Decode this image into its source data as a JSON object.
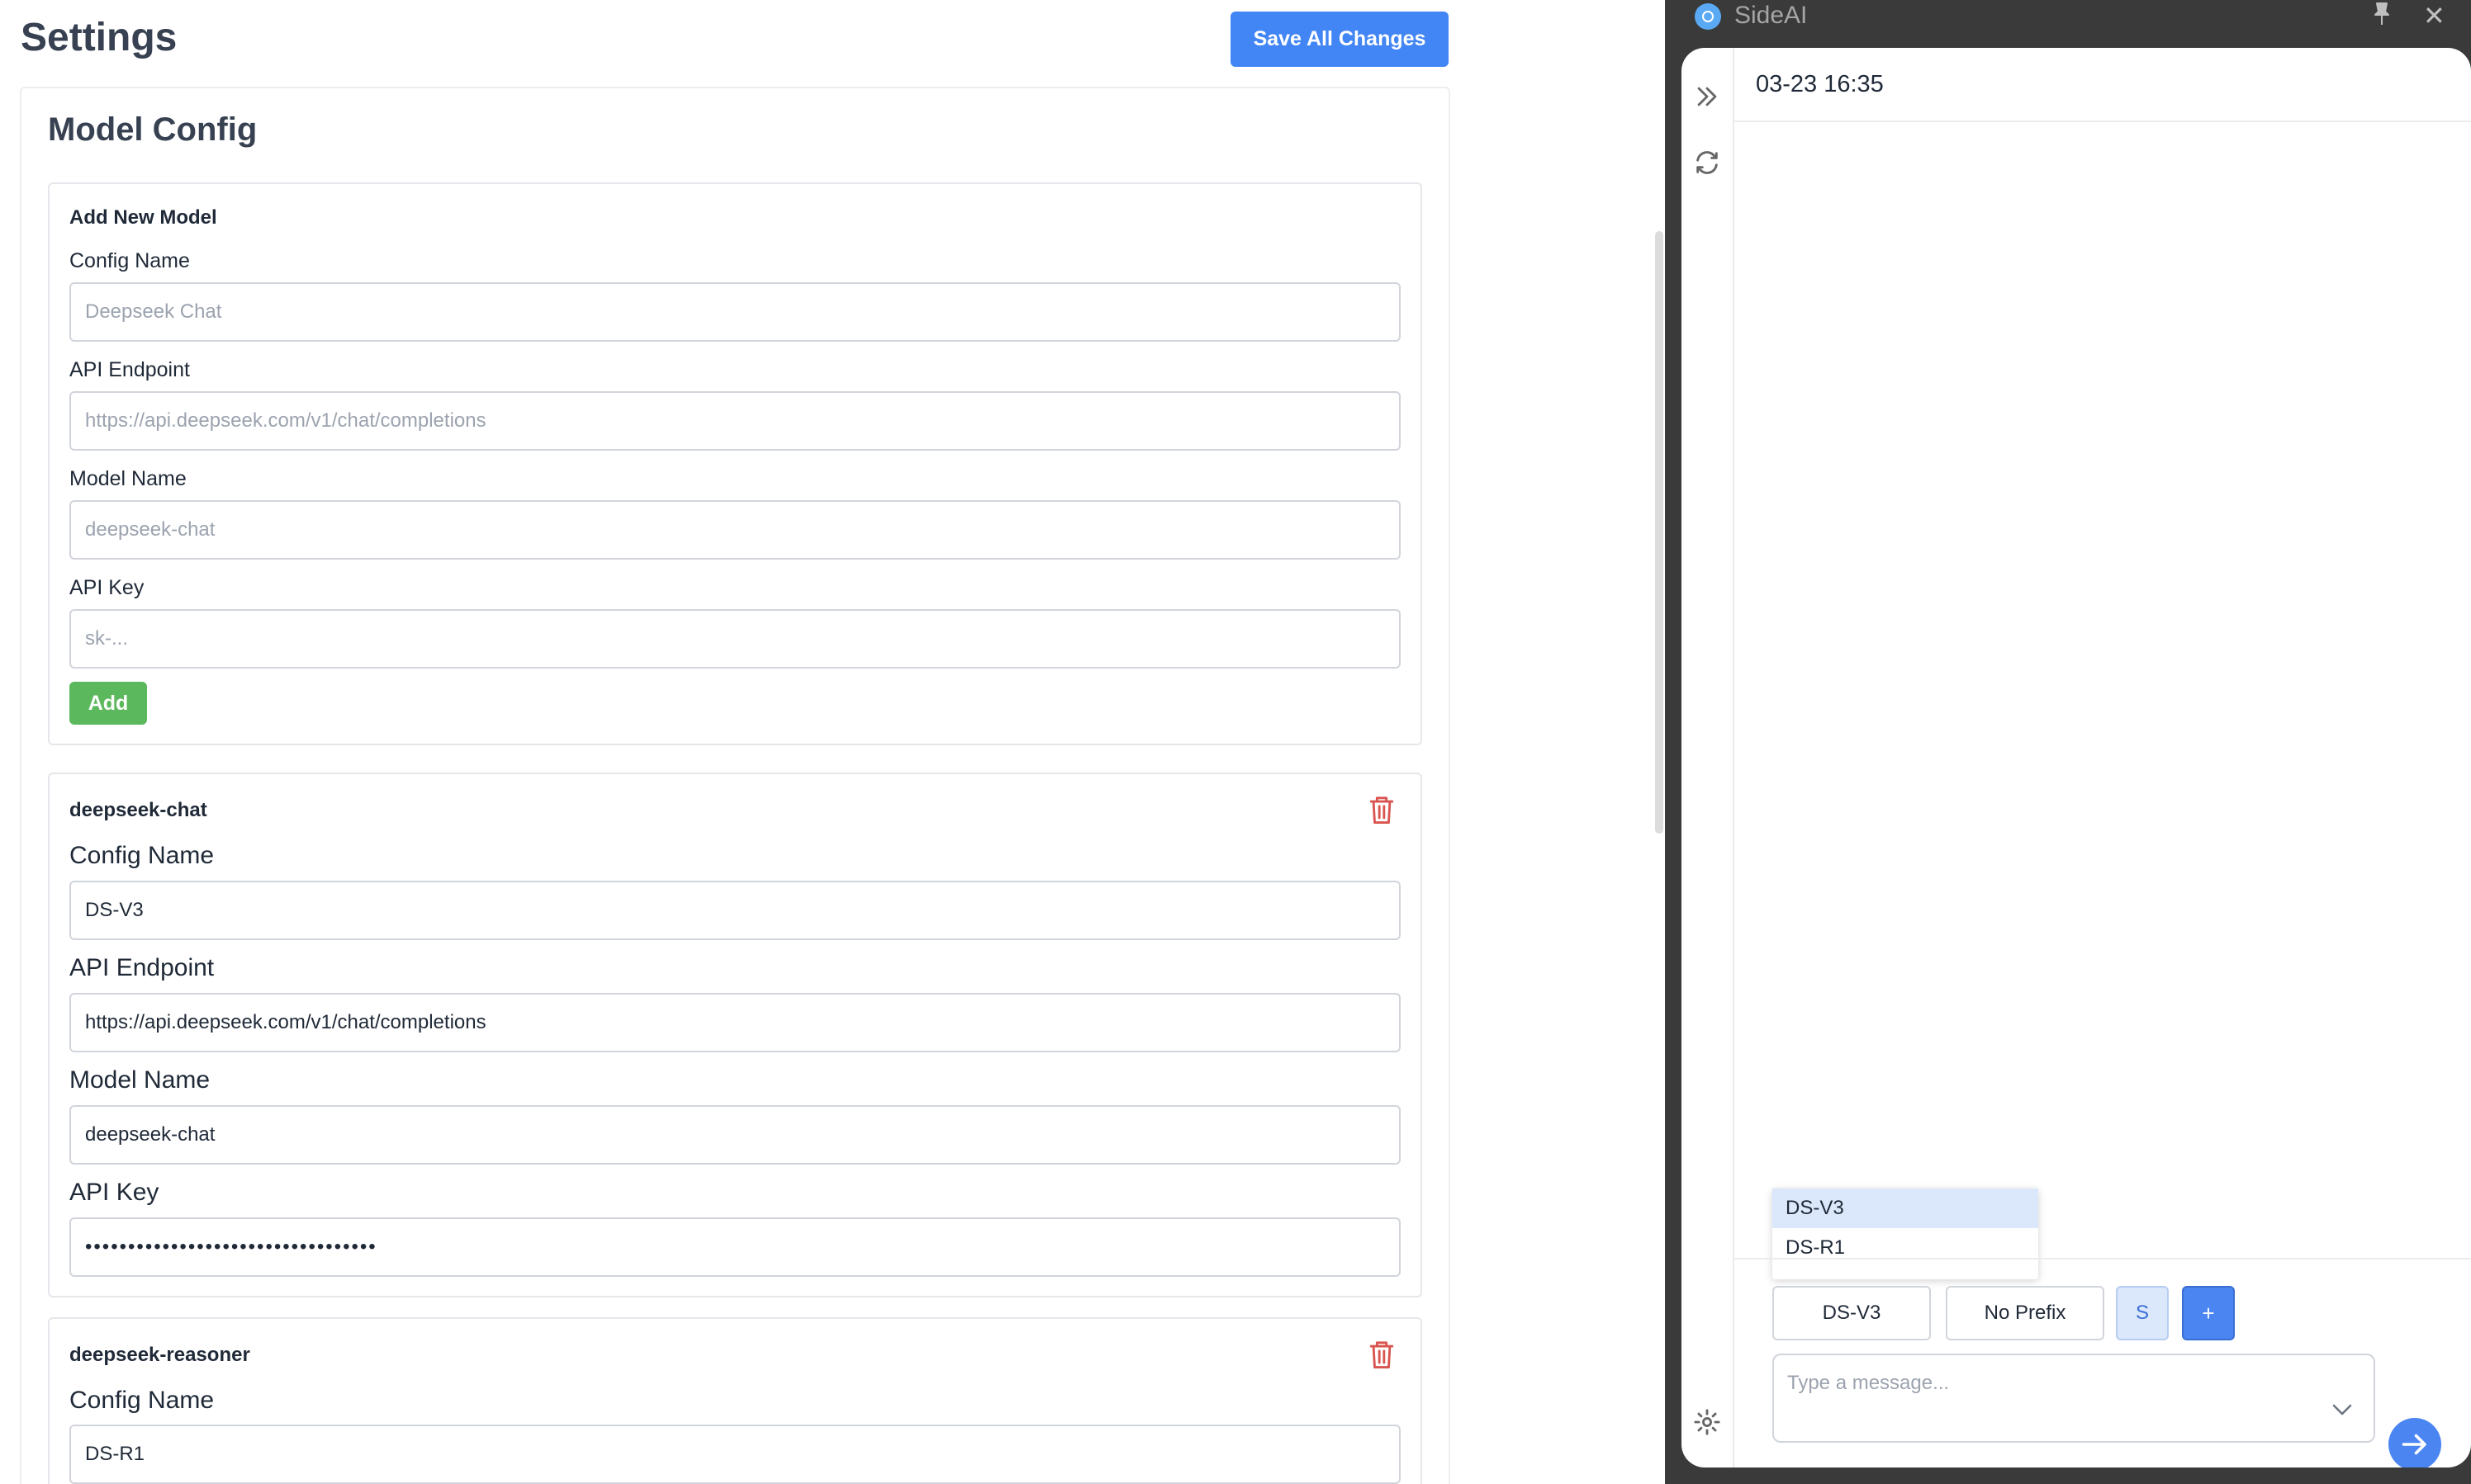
{
  "settings": {
    "title": "Settings",
    "save_all_label": "Save All Changes",
    "section_title": "Model Config",
    "new_model": {
      "title": "Add New Model",
      "config_name_label": "Config Name",
      "config_name_placeholder": "Deepseek Chat",
      "endpoint_label": "API Endpoint",
      "endpoint_placeholder": "https://api.deepseek.com/v1/chat/completions",
      "model_name_label": "Model Name",
      "model_name_placeholder": "deepseek-chat",
      "api_key_label": "API Key",
      "api_key_placeholder": "sk-...",
      "add_label": "Add"
    },
    "models": [
      {
        "title": "deepseek-chat",
        "config_name_label": "Config Name",
        "config_name": "DS-V3",
        "endpoint_label": "API Endpoint",
        "endpoint": "https://api.deepseek.com/v1/chat/completions",
        "model_name_label": "Model Name",
        "model_name": "deepseek-chat",
        "api_key_label": "API Key",
        "api_key": "sk-0000000000000000000000000000000"
      },
      {
        "title": "deepseek-reasoner",
        "config_name_label": "Config Name",
        "config_name": "DS-R1"
      }
    ]
  },
  "sideai": {
    "app_name": "SideAI",
    "chat_timestamp": "03-23 16:35",
    "model_options": [
      "DS-V3",
      "DS-R1"
    ],
    "model_selected": "DS-V3",
    "prefix_label": "No Prefix",
    "s_label": "S",
    "plus_label": "+",
    "message_placeholder": "Type a message..."
  },
  "colors": {
    "primary_blue": "#4285f4",
    "add_green": "#5cb85c",
    "delete_red": "#d9534f",
    "window_chrome": "#3a3a3a"
  },
  "icons": [
    "pin-icon",
    "close-icon",
    "expand-sidebar-icon",
    "refresh-icon",
    "settings-icon",
    "trash-icon",
    "chevron-down-icon",
    "send-arrow-icon"
  ]
}
